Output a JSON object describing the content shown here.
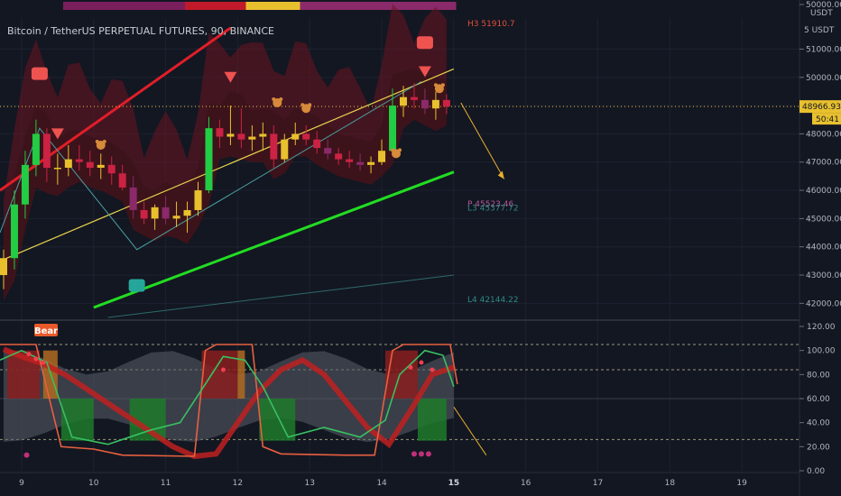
{
  "chart_title": "Bitcoin / TetherUS PERPETUAL FUTURES, 90, BINANCE",
  "currency": "USDT",
  "axis_prefix_label": "5 USDT",
  "top_axis_price": "50000.00",
  "price_badge": "48966.93",
  "countdown_badge": "50:41",
  "signal_label": "Bear",
  "levels": [
    {
      "label": "H3 51910.7",
      "value": 51910.7,
      "color": "#e0503a"
    },
    {
      "label": "P 45523.46",
      "value": 45523.46,
      "color": "#b05a9a"
    },
    {
      "label": "L3 45377.72",
      "value": 45377.72,
      "color": "#2e8a86"
    },
    {
      "label": "L4 42144.22",
      "value": 42144.22,
      "color": "#2e8a86"
    }
  ],
  "colors": {
    "bg": "#131722",
    "channel_upper": "#e01e28",
    "channel_lower": "#22dd22",
    "trend": "#e8d44d",
    "up": "#22cc44",
    "down": "#cc2244",
    "neutral": "#e8c02e"
  },
  "chart_data": [
    {
      "type": "candlestick",
      "x_ticks": [
        "9",
        "10",
        "11",
        "12",
        "13",
        "14",
        "15",
        "16",
        "17",
        "18",
        "19"
      ],
      "y_ticks": [
        "50000.00",
        "51000.00",
        "50000.00",
        "49000.00",
        "48000.00",
        "47000.00",
        "46000.00",
        "45000.00",
        "44000.00",
        "43000.00",
        "42000.00"
      ],
      "ylim": [
        41500,
        52100
      ],
      "xlim": [
        8.7,
        19.8
      ],
      "current_price": 48966.93,
      "candles": [
        {
          "x": 8.75,
          "o": 43000,
          "h": 43900,
          "l": 42500,
          "c": 43600
        },
        {
          "x": 8.9,
          "o": 43600,
          "h": 46000,
          "l": 43200,
          "c": 45500
        },
        {
          "x": 9.05,
          "o": 45500,
          "h": 47400,
          "l": 45000,
          "c": 46900
        },
        {
          "x": 9.2,
          "o": 46900,
          "h": 48500,
          "l": 46500,
          "c": 48000
        },
        {
          "x": 9.35,
          "o": 48000,
          "h": 48200,
          "l": 46300,
          "c": 46800
        },
        {
          "x": 9.5,
          "o": 46800,
          "h": 47300,
          "l": 46200,
          "c": 46800
        },
        {
          "x": 9.65,
          "o": 46800,
          "h": 47600,
          "l": 46500,
          "c": 47100
        },
        {
          "x": 9.8,
          "o": 47100,
          "h": 47600,
          "l": 46700,
          "c": 47000
        },
        {
          "x": 9.95,
          "o": 47000,
          "h": 47400,
          "l": 46500,
          "c": 46800
        },
        {
          "x": 10.1,
          "o": 46800,
          "h": 47300,
          "l": 46400,
          "c": 46900
        },
        {
          "x": 10.25,
          "o": 46900,
          "h": 47200,
          "l": 46200,
          "c": 46600
        },
        {
          "x": 10.4,
          "o": 46600,
          "h": 46900,
          "l": 46000,
          "c": 46100
        },
        {
          "x": 10.55,
          "o": 46100,
          "h": 46500,
          "l": 45000,
          "c": 45300
        },
        {
          "x": 10.7,
          "o": 45300,
          "h": 45600,
          "l": 44800,
          "c": 45000
        },
        {
          "x": 10.85,
          "o": 45000,
          "h": 45500,
          "l": 44600,
          "c": 45400
        },
        {
          "x": 11.0,
          "o": 45400,
          "h": 45800,
          "l": 44800,
          "c": 45000
        },
        {
          "x": 11.15,
          "o": 45000,
          "h": 45600,
          "l": 44700,
          "c": 45100
        },
        {
          "x": 11.3,
          "o": 45100,
          "h": 45600,
          "l": 44500,
          "c": 45300
        },
        {
          "x": 11.45,
          "o": 45300,
          "h": 46300,
          "l": 45100,
          "c": 46000
        },
        {
          "x": 11.6,
          "o": 46000,
          "h": 48600,
          "l": 45900,
          "c": 48200
        },
        {
          "x": 11.75,
          "o": 48200,
          "h": 48500,
          "l": 47500,
          "c": 47900
        },
        {
          "x": 11.9,
          "o": 47900,
          "h": 49000,
          "l": 47600,
          "c": 48000
        },
        {
          "x": 12.05,
          "o": 48000,
          "h": 48900,
          "l": 47500,
          "c": 47800
        },
        {
          "x": 12.2,
          "o": 47800,
          "h": 48300,
          "l": 47400,
          "c": 47900
        },
        {
          "x": 12.35,
          "o": 47900,
          "h": 48400,
          "l": 47400,
          "c": 48000
        },
        {
          "x": 12.5,
          "o": 48000,
          "h": 48300,
          "l": 46800,
          "c": 47100
        },
        {
          "x": 12.65,
          "o": 47100,
          "h": 48000,
          "l": 47000,
          "c": 47800
        },
        {
          "x": 12.8,
          "o": 47800,
          "h": 48400,
          "l": 47600,
          "c": 48000
        },
        {
          "x": 12.95,
          "o": 48000,
          "h": 48300,
          "l": 47600,
          "c": 47800
        },
        {
          "x": 13.1,
          "o": 47800,
          "h": 48100,
          "l": 47300,
          "c": 47500
        },
        {
          "x": 13.25,
          "o": 47500,
          "h": 47800,
          "l": 47100,
          "c": 47300
        },
        {
          "x": 13.4,
          "o": 47300,
          "h": 47500,
          "l": 46900,
          "c": 47100
        },
        {
          "x": 13.55,
          "o": 47100,
          "h": 47400,
          "l": 46800,
          "c": 47000
        },
        {
          "x": 13.7,
          "o": 47000,
          "h": 47300,
          "l": 46700,
          "c": 46900
        },
        {
          "x": 13.85,
          "o": 46900,
          "h": 47200,
          "l": 46600,
          "c": 47000
        },
        {
          "x": 14.0,
          "o": 47000,
          "h": 47800,
          "l": 46900,
          "c": 47400
        },
        {
          "x": 14.15,
          "o": 47400,
          "h": 49600,
          "l": 47300,
          "c": 49000
        },
        {
          "x": 14.3,
          "o": 49000,
          "h": 49700,
          "l": 48600,
          "c": 49300
        },
        {
          "x": 14.45,
          "o": 49300,
          "h": 49800,
          "l": 48900,
          "c": 49200
        },
        {
          "x": 14.6,
          "o": 49200,
          "h": 49600,
          "l": 48700,
          "c": 48900
        },
        {
          "x": 14.75,
          "o": 48900,
          "h": 49500,
          "l": 48500,
          "c": 49200
        },
        {
          "x": 14.9,
          "o": 49200,
          "h": 49400,
          "l": 48700,
          "c": 48967
        }
      ],
      "channel_upper": [
        [
          8.7,
          46000
        ],
        [
          11.9,
          51750
        ]
      ],
      "channel_lower": [
        [
          10.0,
          41850
        ],
        [
          15.0,
          46650
        ]
      ],
      "channel_mid": [
        [
          8.7,
          43500
        ],
        [
          15.0,
          50300
        ]
      ],
      "channel_bottom_teal": [
        [
          10.2,
          41500
        ],
        [
          15.0,
          43000
        ]
      ],
      "zigzag": [
        [
          8.7,
          44500
        ],
        [
          9.25,
          48200
        ],
        [
          10.6,
          43900
        ],
        [
          14.55,
          49850
        ]
      ],
      "projection": [
        [
          15.1,
          49100
        ],
        [
          15.7,
          46400
        ]
      ],
      "markers": [
        {
          "x": 9.25,
          "y": 50100,
          "kind": "flag-red"
        },
        {
          "x": 9.5,
          "y": 48000,
          "kind": "tri-down"
        },
        {
          "x": 10.1,
          "y": 47600,
          "kind": "bear"
        },
        {
          "x": 10.6,
          "y": 42600,
          "kind": "flag-green"
        },
        {
          "x": 11.9,
          "y": 50000,
          "kind": "tri-down"
        },
        {
          "x": 12.55,
          "y": 49100,
          "kind": "bear"
        },
        {
          "x": 12.95,
          "y": 48900,
          "kind": "bear"
        },
        {
          "x": 14.2,
          "y": 47300,
          "kind": "bear"
        },
        {
          "x": 14.6,
          "y": 51200,
          "kind": "flag-red"
        },
        {
          "x": 14.6,
          "y": 50200,
          "kind": "tri-down"
        },
        {
          "x": 14.8,
          "y": 49600,
          "kind": "bear"
        }
      ]
    },
    {
      "type": "line",
      "y_ticks": [
        "120.00",
        "100.00",
        "80.00",
        "60.00",
        "40.00",
        "20.00",
        "0.00"
      ],
      "ylim": [
        0,
        120
      ],
      "xlim": [
        8.7,
        19.8
      ],
      "reference_lines": [
        105,
        84,
        60,
        26
      ],
      "series": [
        {
          "color": "#e86040",
          "points": [
            [
              8.7,
              105
            ],
            [
              9.2,
              105
            ],
            [
              9.55,
              20
            ],
            [
              10.0,
              18
            ],
            [
              10.4,
              13
            ],
            [
              11.4,
              12
            ],
            [
              11.55,
              100
            ],
            [
              11.7,
              105
            ],
            [
              12.2,
              105
            ],
            [
              12.35,
              20
            ],
            [
              12.6,
              14
            ],
            [
              13.5,
              13
            ],
            [
              13.9,
              13
            ],
            [
              14.15,
              100
            ],
            [
              14.3,
              105
            ],
            [
              14.95,
              105
            ],
            [
              15.05,
              72
            ]
          ]
        },
        {
          "color": "#38c060",
          "points": [
            [
              8.7,
              92
            ],
            [
              9.0,
              100
            ],
            [
              9.35,
              90
            ],
            [
              9.7,
              28
            ],
            [
              10.2,
              22
            ],
            [
              10.8,
              34
            ],
            [
              11.2,
              40
            ],
            [
              11.55,
              72
            ],
            [
              11.8,
              95
            ],
            [
              12.1,
              92
            ],
            [
              12.35,
              70
            ],
            [
              12.7,
              28
            ],
            [
              13.2,
              36
            ],
            [
              13.7,
              28
            ],
            [
              14.05,
              42
            ],
            [
              14.25,
              80
            ],
            [
              14.6,
              100
            ],
            [
              14.85,
              96
            ],
            [
              15.0,
              70
            ]
          ]
        }
      ],
      "ribbon": [
        [
          8.75,
          101
        ],
        [
          9.0,
          95
        ],
        [
          9.3,
          89
        ],
        [
          9.6,
          80
        ],
        [
          9.9,
          68
        ],
        [
          10.2,
          56
        ],
        [
          10.5,
          44
        ],
        [
          10.8,
          32
        ],
        [
          11.1,
          20
        ],
        [
          11.4,
          12
        ],
        [
          11.7,
          14
        ],
        [
          12.0,
          40
        ],
        [
          12.3,
          66
        ],
        [
          12.6,
          84
        ],
        [
          12.9,
          92
        ],
        [
          13.2,
          80
        ],
        [
          13.5,
          58
        ],
        [
          13.8,
          36
        ],
        [
          14.1,
          22
        ],
        [
          14.4,
          50
        ],
        [
          14.7,
          80
        ],
        [
          15.0,
          86
        ]
      ],
      "projection": [
        [
          15.0,
          53
        ],
        [
          15.45,
          13
        ]
      ]
    }
  ]
}
